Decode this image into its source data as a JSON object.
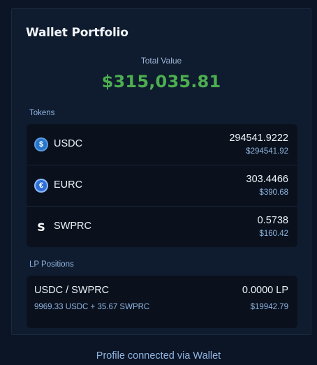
{
  "portfolio": {
    "title": "Wallet Portfolio",
    "total_label": "Total Value",
    "total_value": "$315,035.81"
  },
  "tokens": {
    "label": "Tokens",
    "items": [
      {
        "icon": "usdc-icon",
        "name": "USDC",
        "amount": "294541.9222",
        "usd": "$294541.92"
      },
      {
        "icon": "eurc-icon",
        "name": "EURC",
        "amount": "303.4466",
        "usd": "$390.68"
      },
      {
        "icon": "swprc-icon",
        "name": "SWPRC",
        "amount": "0.5738",
        "usd": "$160.42"
      }
    ]
  },
  "lp": {
    "label": "LP Positions",
    "items": [
      {
        "pair": "USDC / SWPRC",
        "amount": "0.0000 LP",
        "detail": "9969.33 USDC + 35.67 SWPRC",
        "usd": "$19942.79"
      }
    ]
  },
  "footer": {
    "text": "Profile connected via Wallet"
  },
  "colors": {
    "background": "#0c1526",
    "panel": "#0f1b2e",
    "total_value": "#4caf50",
    "muted_text": "#8fb4e0"
  }
}
